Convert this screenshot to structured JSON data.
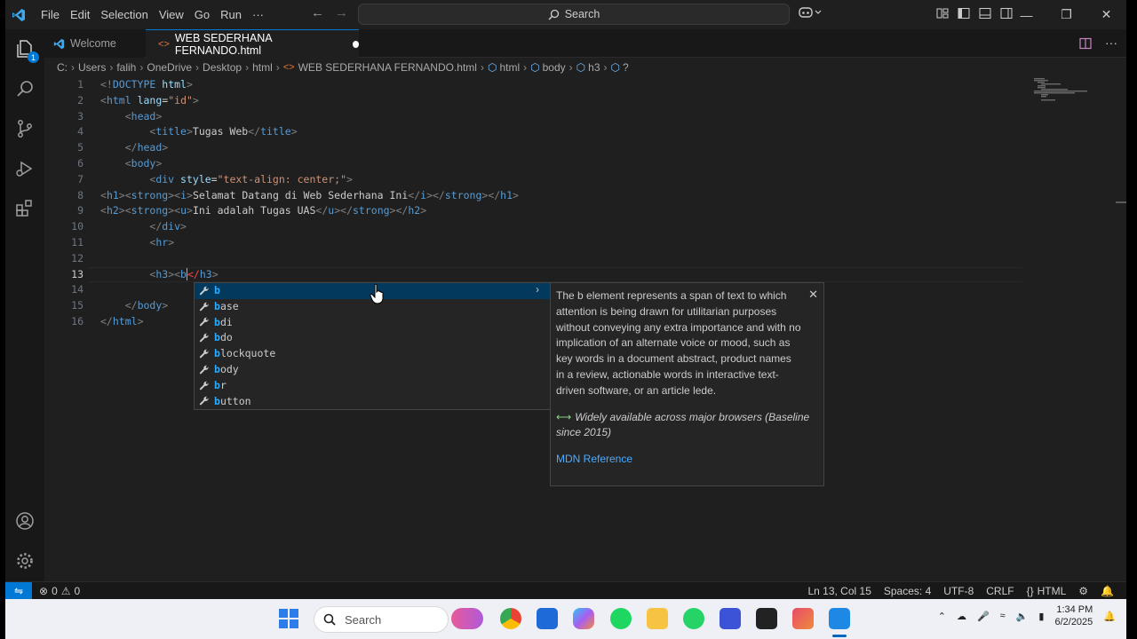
{
  "menu": [
    "File",
    "Edit",
    "Selection",
    "View",
    "Go",
    "Run",
    "···"
  ],
  "search": {
    "label": "Search"
  },
  "tabs": {
    "welcome": "Welcome",
    "active": "WEB SEDERHANA FERNANDO.html"
  },
  "breadcrumb": [
    "C:",
    "Users",
    "falih",
    "OneDrive",
    "Desktop",
    "html",
    "WEB SEDERHANA FERNANDO.html",
    "html",
    "body",
    "h3",
    "?"
  ],
  "editor": {
    "current_line": 13,
    "line_numbers": [
      "1",
      "2",
      "3",
      "4",
      "5",
      "6",
      "7",
      "8",
      "9",
      "10",
      "11",
      "12",
      "13",
      "14",
      "15",
      "16"
    ]
  },
  "suggest": {
    "items": [
      "b",
      "base",
      "bdi",
      "bdo",
      "blockquote",
      "body",
      "br",
      "button"
    ],
    "selected_index": 0
  },
  "docs": {
    "description": "The b element represents a span of text to which attention is being drawn for utilitarian purposes without conveying any extra importance and with no implication of an alternate voice or mood, such as key words in a document abstract, product names in a review, actionable words in interactive text-driven software, or an article lede.",
    "baseline": "Widely available across major browsers (Baseline since 2015)",
    "link": "MDN Reference"
  },
  "status": {
    "errors": "0",
    "warnings": "0",
    "position": "Ln 13, Col 15",
    "spaces": "Spaces: 4",
    "encoding": "UTF-8",
    "eol": "CRLF",
    "language": "HTML"
  },
  "taskbar": {
    "search_label": "Search",
    "time": "1:34 PM",
    "date": "6/2/2025"
  },
  "colors": {
    "accent": "#0078d4",
    "tag": "#569cd6",
    "attribute": "#9cdcfe",
    "string": "#ce9178"
  }
}
